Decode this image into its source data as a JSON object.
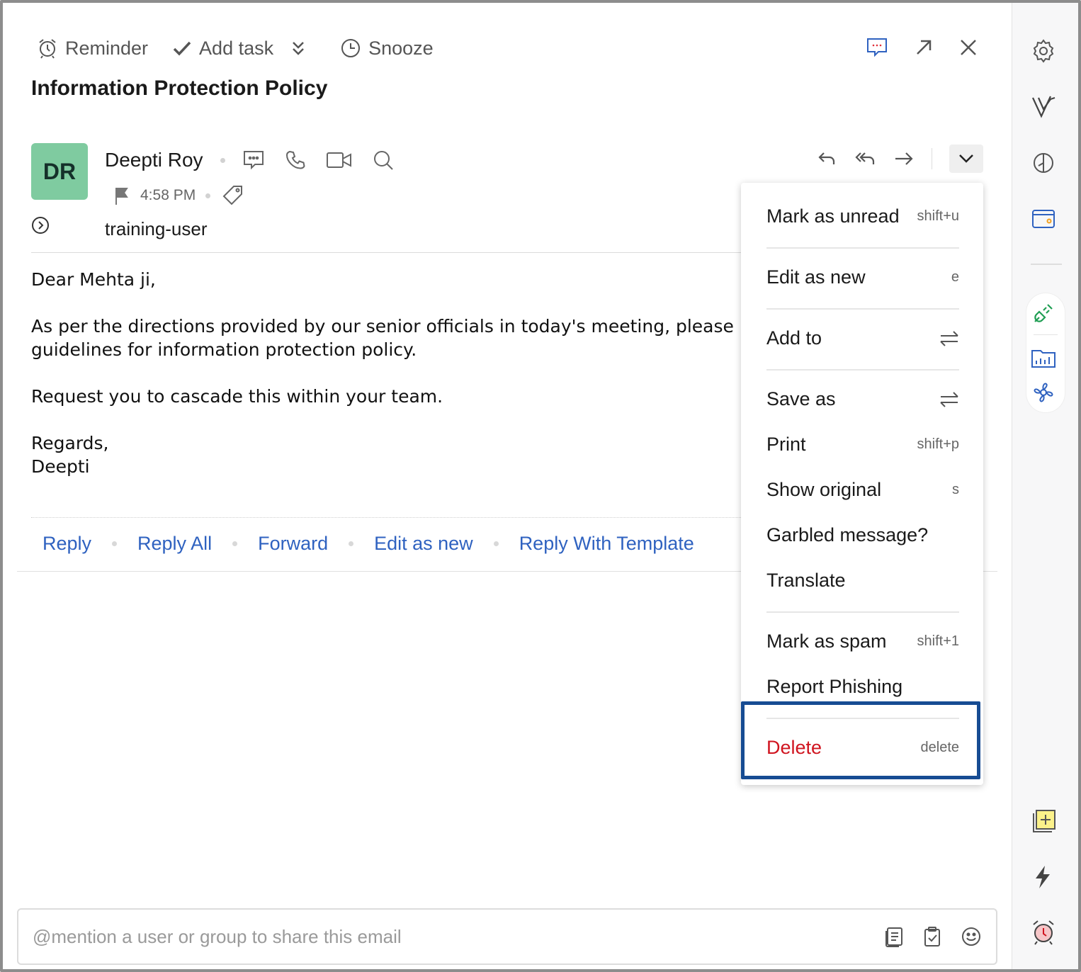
{
  "toolbar": {
    "reminder": "Reminder",
    "add_task": "Add task",
    "snooze": "Snooze"
  },
  "subject": "Information Protection Policy",
  "sender": {
    "initials": "DR",
    "avatar_color": "#7fcba0",
    "name": "Deepti Roy",
    "time": "4:58 PM",
    "to": "training-user"
  },
  "body": {
    "greeting": "Dear Mehta ji,",
    "para1_line1": "As per the directions provided by our senior officials in today's meeting, please",
    "para1_line2": "guidelines for information protection policy.",
    "para2": "Request you to cascade this within your team.",
    "closing": "Regards,",
    "signature": "Deepti"
  },
  "quick_links": [
    "Reply",
    "Reply All",
    "Forward",
    "Edit as new",
    "Reply With Template"
  ],
  "share": {
    "placeholder": "@mention a user or group to share this email"
  },
  "menu": {
    "items": [
      {
        "label": "Mark as unread",
        "shortcut": "shift+u"
      },
      {
        "label": "Edit as new",
        "shortcut": "e"
      },
      {
        "label": "Add to",
        "shortcut_icon": "swap-arrows-icon"
      },
      {
        "label": "Save as",
        "shortcut_icon": "swap-arrows-icon"
      },
      {
        "label": "Print",
        "shortcut": "shift+p"
      },
      {
        "label": "Show original",
        "shortcut": "s"
      },
      {
        "label": "Garbled message?"
      },
      {
        "label": "Translate"
      },
      {
        "label": "Mark as spam",
        "shortcut": "shift+1"
      },
      {
        "label": "Report Phishing"
      },
      {
        "label": "Delete",
        "shortcut": "delete"
      }
    ]
  },
  "colors": {
    "link": "#2f62c0",
    "delete": "#d0141f",
    "highlight_border": "#174c93"
  }
}
